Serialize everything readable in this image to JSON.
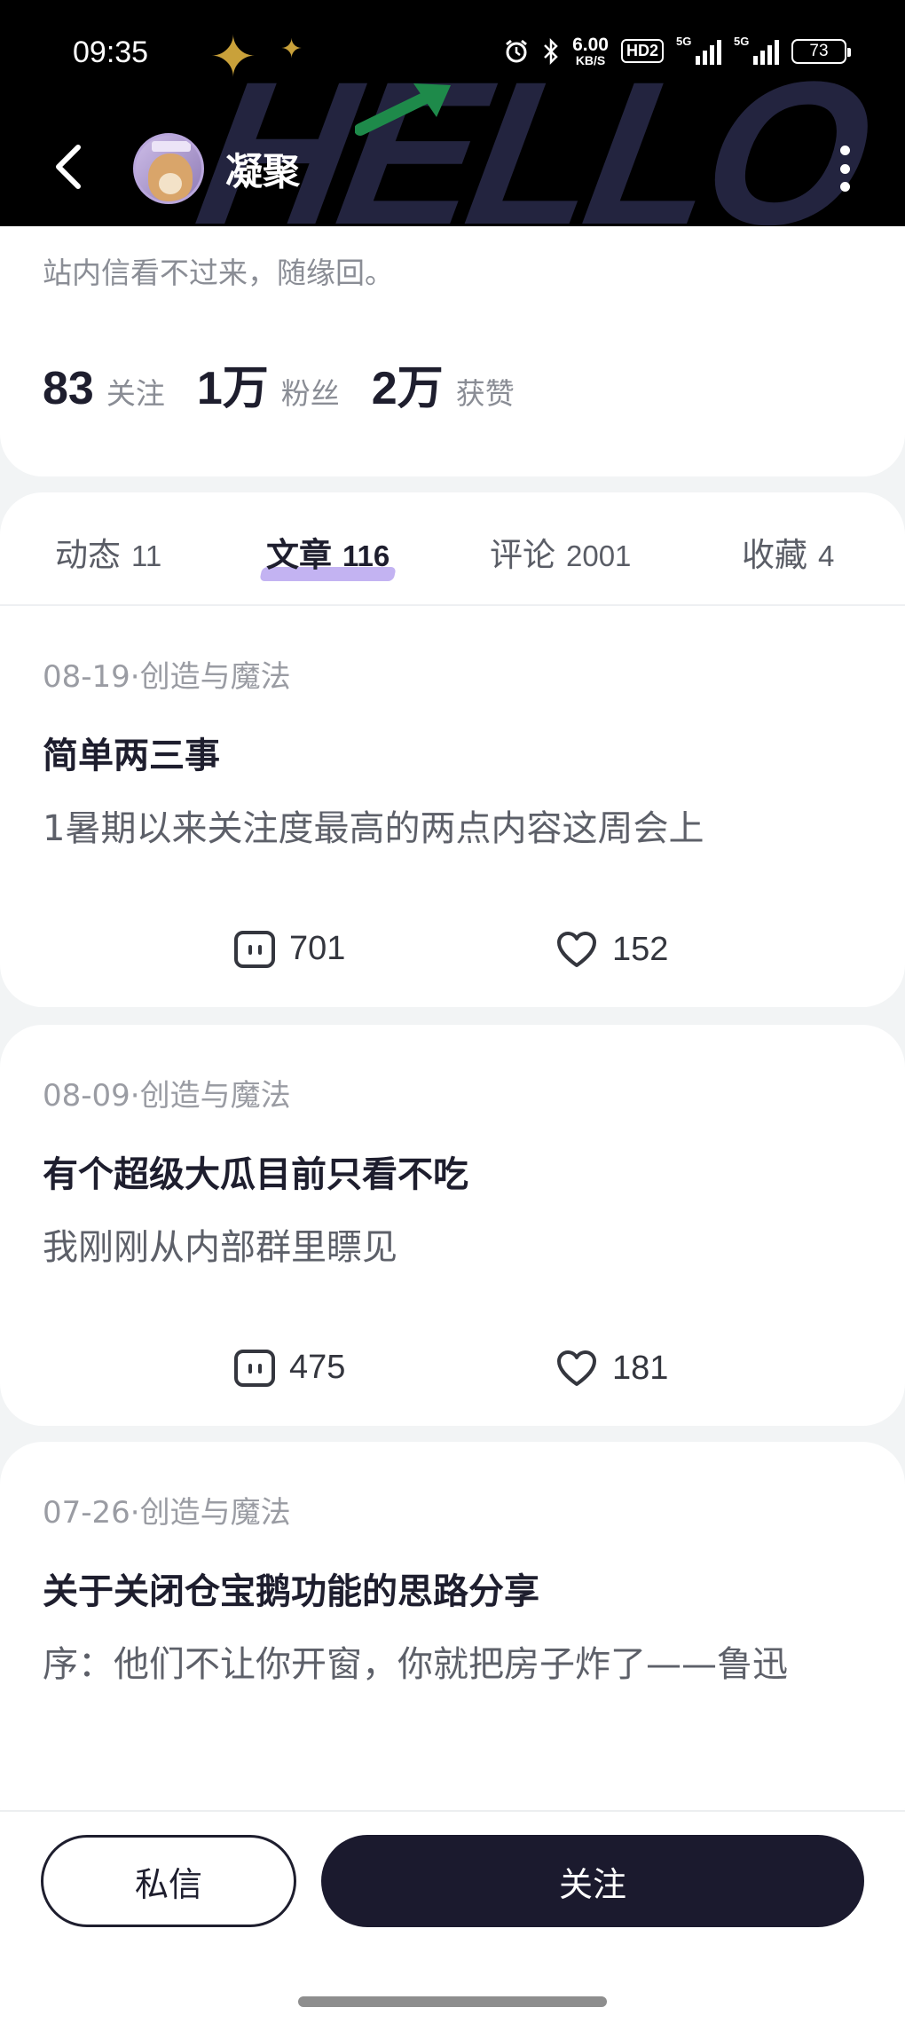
{
  "status_bar": {
    "time": "09:35",
    "net_speed_value": "6.00",
    "net_speed_unit": "KB/S",
    "hd_label": "HD2",
    "signal_1_label": "5G",
    "signal_2_label": "5G",
    "battery": "73"
  },
  "nav": {
    "name": "凝聚",
    "header_art_text": "HELLO"
  },
  "profile": {
    "bio": "站内信看不过来，随缘回。",
    "stats": [
      {
        "num": "83",
        "label": "关注"
      },
      {
        "num": "1万",
        "label": "粉丝"
      },
      {
        "num": "2万",
        "label": "获赞"
      }
    ]
  },
  "tabs": [
    {
      "label": "动态",
      "count": "11"
    },
    {
      "label": "文章",
      "count": "116"
    },
    {
      "label": "评论",
      "count": "2001"
    },
    {
      "label": "收藏",
      "count": "4"
    }
  ],
  "active_tab": "文章",
  "articles": [
    {
      "meta": "08-19·创造与魔法",
      "title": "简单两三事",
      "excerpt": "1暑期以来关注度最高的两点内容这周会上",
      "comments": "701",
      "likes": "152"
    },
    {
      "meta": "08-09·创造与魔法",
      "title": "有个超级大瓜目前只看不吃",
      "excerpt": "我刚刚从内部群里瞟见",
      "comments": "475",
      "likes": "181"
    },
    {
      "meta": "07-26·创造与魔法",
      "title": "关于关闭仓宝鹅功能的思路分享",
      "excerpt": "序：他们不让你开窗，你就把房子炸了——鲁迅"
    }
  ],
  "bottom": {
    "message_label": "私信",
    "follow_label": "关注"
  },
  "colors": {
    "accent_highlight": "#b9a6f0",
    "primary_button": "#1b1a2e",
    "header_bg": "#000000"
  }
}
